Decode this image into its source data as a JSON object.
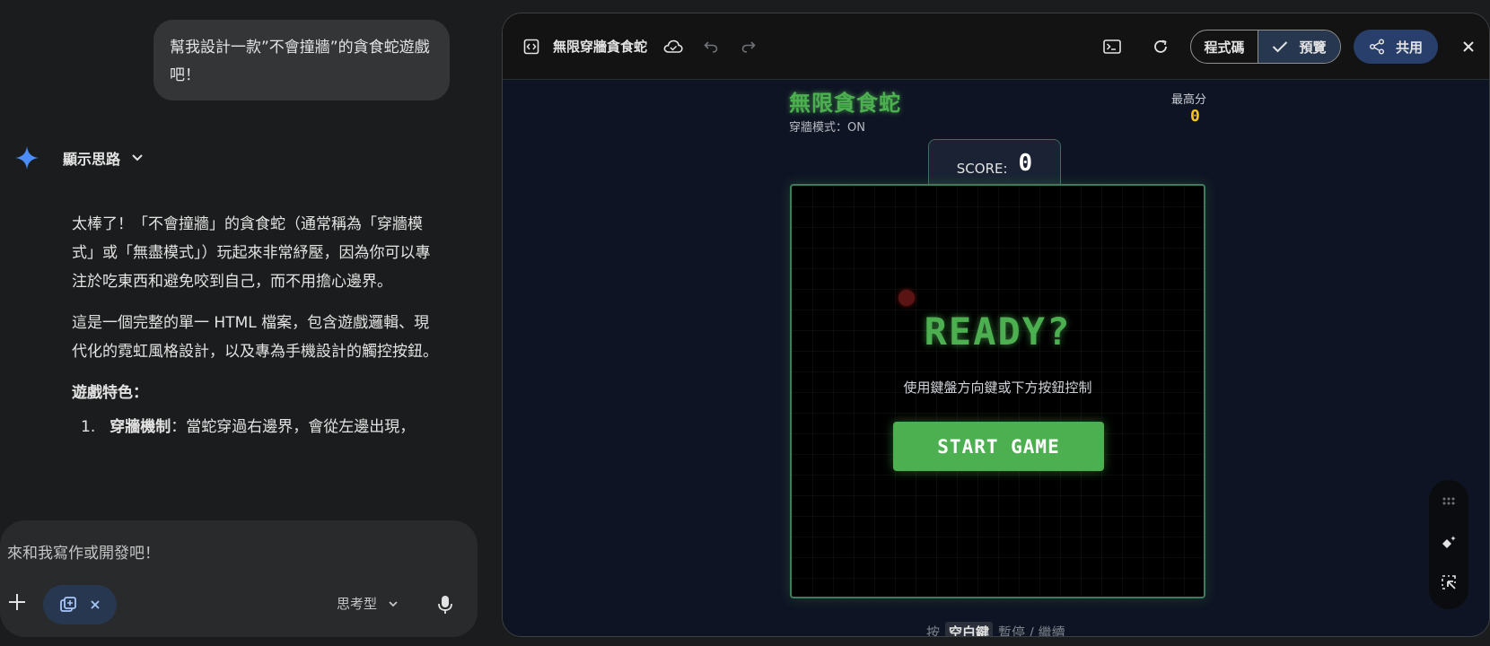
{
  "chat": {
    "user_message": "幫我設計一款”不會撞牆”的貪食蛇遊戲吧！",
    "thought_label": "顯示思路",
    "reply": {
      "p1": "太棒了！「不會撞牆」的貪食蛇（通常稱為「穿牆模式」或「無盡模式」）玩起來非常紓壓，因為你可以專注於吃東西和避免咬到自己，而不用擔心邊界。",
      "p2": "這是一個完整的單一 HTML 檔案，包含遊戲邏輯、現代化的霓虹風格設計，以及專為手機設計的觸控按鈕。",
      "features_heading": "遊戲特色：",
      "feature1_num": "1.",
      "feature1_title": "穿牆機制",
      "feature1_text": "：當蛇穿過右邊界，會從左邊出現，"
    }
  },
  "composer": {
    "placeholder": "來和我寫作或開發吧！",
    "mode_label": "思考型"
  },
  "panel": {
    "doc_title": "無限穿牆貪食蛇",
    "code_tab": "程式碼",
    "preview_tab": "預覽",
    "share_label": "共用"
  },
  "game": {
    "title": "無限貪食蛇",
    "wrap_mode": "穿牆模式：ON",
    "best_label": "最高分",
    "best_value": "0",
    "score_label": "SCORE:",
    "score_value": "0",
    "ready_text": "READY?",
    "hint_text": "使用鍵盤方向鍵或下方按鈕控制",
    "start_label": "START GAME",
    "bottom_prefix": "按",
    "bottom_key": "空白鍵",
    "bottom_suffix": "暫停 / 繼續"
  },
  "colors": {
    "accent_green": "#4caf50",
    "score_gold": "#f5c518",
    "share_blue": "#283f6b",
    "panel_bg": "#131314",
    "stage_bg": "#0f1424"
  }
}
